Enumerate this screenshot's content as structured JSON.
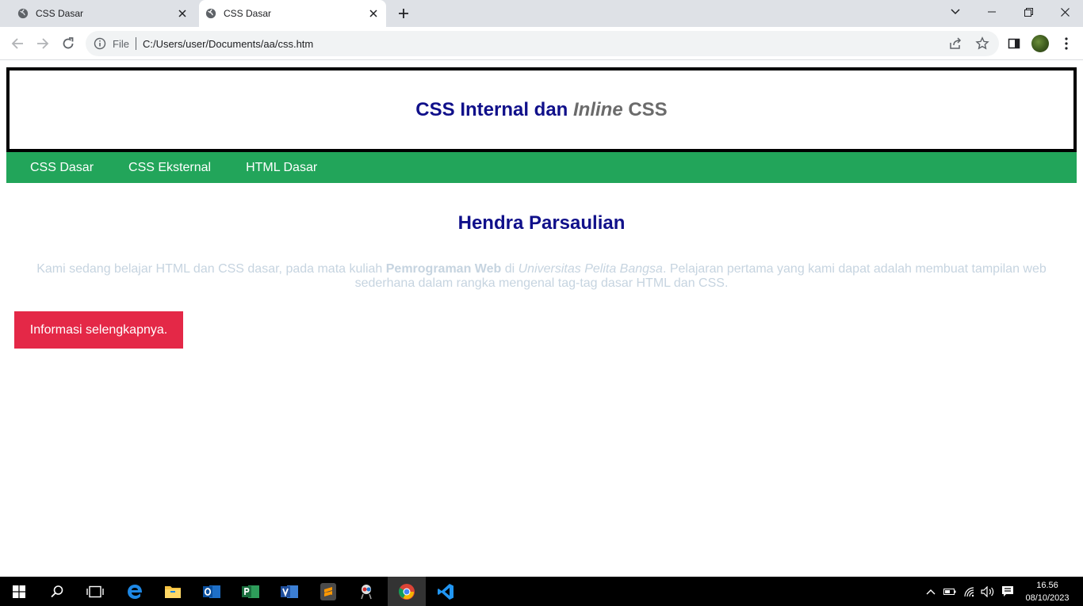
{
  "browser": {
    "tabs": [
      {
        "title": "CSS Dasar",
        "active": false
      },
      {
        "title": "CSS Dasar",
        "active": true
      }
    ],
    "address": {
      "scheme_label": "File",
      "url": "C:/Users/user/Documents/aa/css.htm"
    }
  },
  "page": {
    "header": {
      "title_part1": "CSS Internal dan ",
      "title_italic": "Inline",
      "title_part3": " CSS"
    },
    "nav": [
      {
        "label": "CSS Dasar"
      },
      {
        "label": "CSS Eksternal"
      },
      {
        "label": "HTML Dasar"
      }
    ],
    "content_title": "Hendra Parsaulian",
    "paragraph": {
      "text1": "Kami sedang belajar HTML dan CSS dasar, pada mata kuliah ",
      "bold": "Pemrograman Web",
      "text2": " di ",
      "italic": "Universitas Pelita Bangsa",
      "text3": ". Pelajaran pertama yang kami dapat adalah membuat tampilan web sederhana dalam rangka mengenal tag-tag dasar HTML dan CSS."
    },
    "button_label": "Informasi selengkapnya."
  },
  "taskbar": {
    "time": "16.56",
    "date": "08/10/2023"
  },
  "colors": {
    "header_text": "#10108a",
    "nav_bg": "#22a55a",
    "button_bg": "#e42847",
    "paragraph_text": "#c6d4e0"
  }
}
